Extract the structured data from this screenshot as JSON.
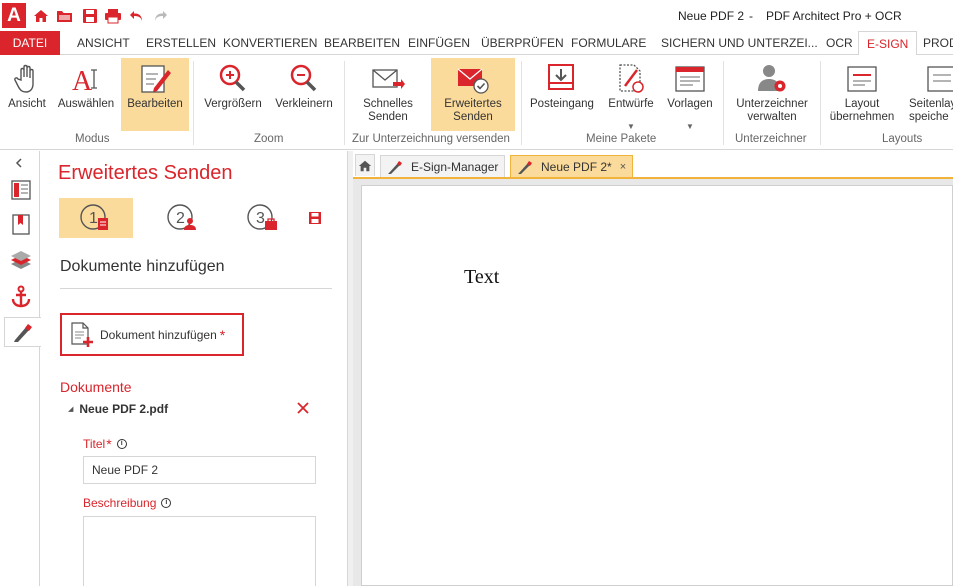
{
  "window": {
    "doc_name": "Neue PDF 2",
    "separator": "-",
    "app_name": "PDF Architect Pro + OCR",
    "logo_letter": "A"
  },
  "quick_access": [
    "home-icon",
    "folder-icon",
    "save-icon",
    "print-icon",
    "undo-icon",
    "redo-icon"
  ],
  "tabs": [
    "DATEI",
    "ANSICHT",
    "ERSTELLEN",
    "KONVERTIEREN",
    "BEARBEITEN",
    "EINFÜGEN",
    "ÜBERPRÜFEN",
    "FORMULARE",
    "SICHERN UND UNTERZEI...",
    "OCR",
    "E-SIGN",
    "PROD"
  ],
  "active_tab": "E-SIGN",
  "ribbon": {
    "buttons": [
      {
        "label": "Ansicht",
        "icon": "hand-icon"
      },
      {
        "label": "Auswählen",
        "icon": "text-select-icon"
      },
      {
        "label": "Bearbeiten",
        "icon": "edit-icon"
      },
      {
        "label": "Vergrößern",
        "icon": "zoom-in-icon"
      },
      {
        "label": "Verkleinern",
        "icon": "zoom-out-icon"
      },
      {
        "label": "Schnelles\nSenden",
        "icon": "quick-send-icon"
      },
      {
        "label": "Erweitertes\nSenden",
        "icon": "advanced-send-icon"
      },
      {
        "label": "Posteingang",
        "icon": "inbox-icon"
      },
      {
        "label": "Entwürfe",
        "icon": "drafts-icon"
      },
      {
        "label": "Vorlagen",
        "icon": "templates-icon"
      },
      {
        "label": "Unterzeichner\nverwalten",
        "icon": "signer-manage-icon"
      },
      {
        "label": "Layout\nübernehmen",
        "icon": "layout-apply-icon"
      },
      {
        "label": "Seitenlay\nspeiche",
        "icon": "page-layout-save-icon"
      }
    ],
    "groups": [
      "Modus",
      "Zoom",
      "Zur Unterzeichnung versenden",
      "Meine Pakete",
      "Unterzeichner",
      "Layouts"
    ]
  },
  "panel": {
    "title": "Erweitertes Senden",
    "steps": [
      "1",
      "2",
      "3"
    ],
    "section_title": "Dokumente hinzufügen",
    "add_document_label": "Dokument hinzufügen",
    "required_mark": "*",
    "documents_title": "Dokumente",
    "doc_toggle": "◢",
    "document_name": "Neue PDF 2.pdf",
    "title_label": "Titel",
    "title_value": "Neue PDF 2",
    "description_label": "Beschreibung",
    "description_value": ""
  },
  "doc_tabs": [
    {
      "label": "E-Sign-Manager"
    },
    {
      "label": "Neue PDF 2*"
    }
  ],
  "doc_tab_close": "×",
  "page_text": "Text",
  "colors": {
    "accent": "#d9252b",
    "selected": "#fbdb9b",
    "tab_border": "#f2b33a"
  }
}
